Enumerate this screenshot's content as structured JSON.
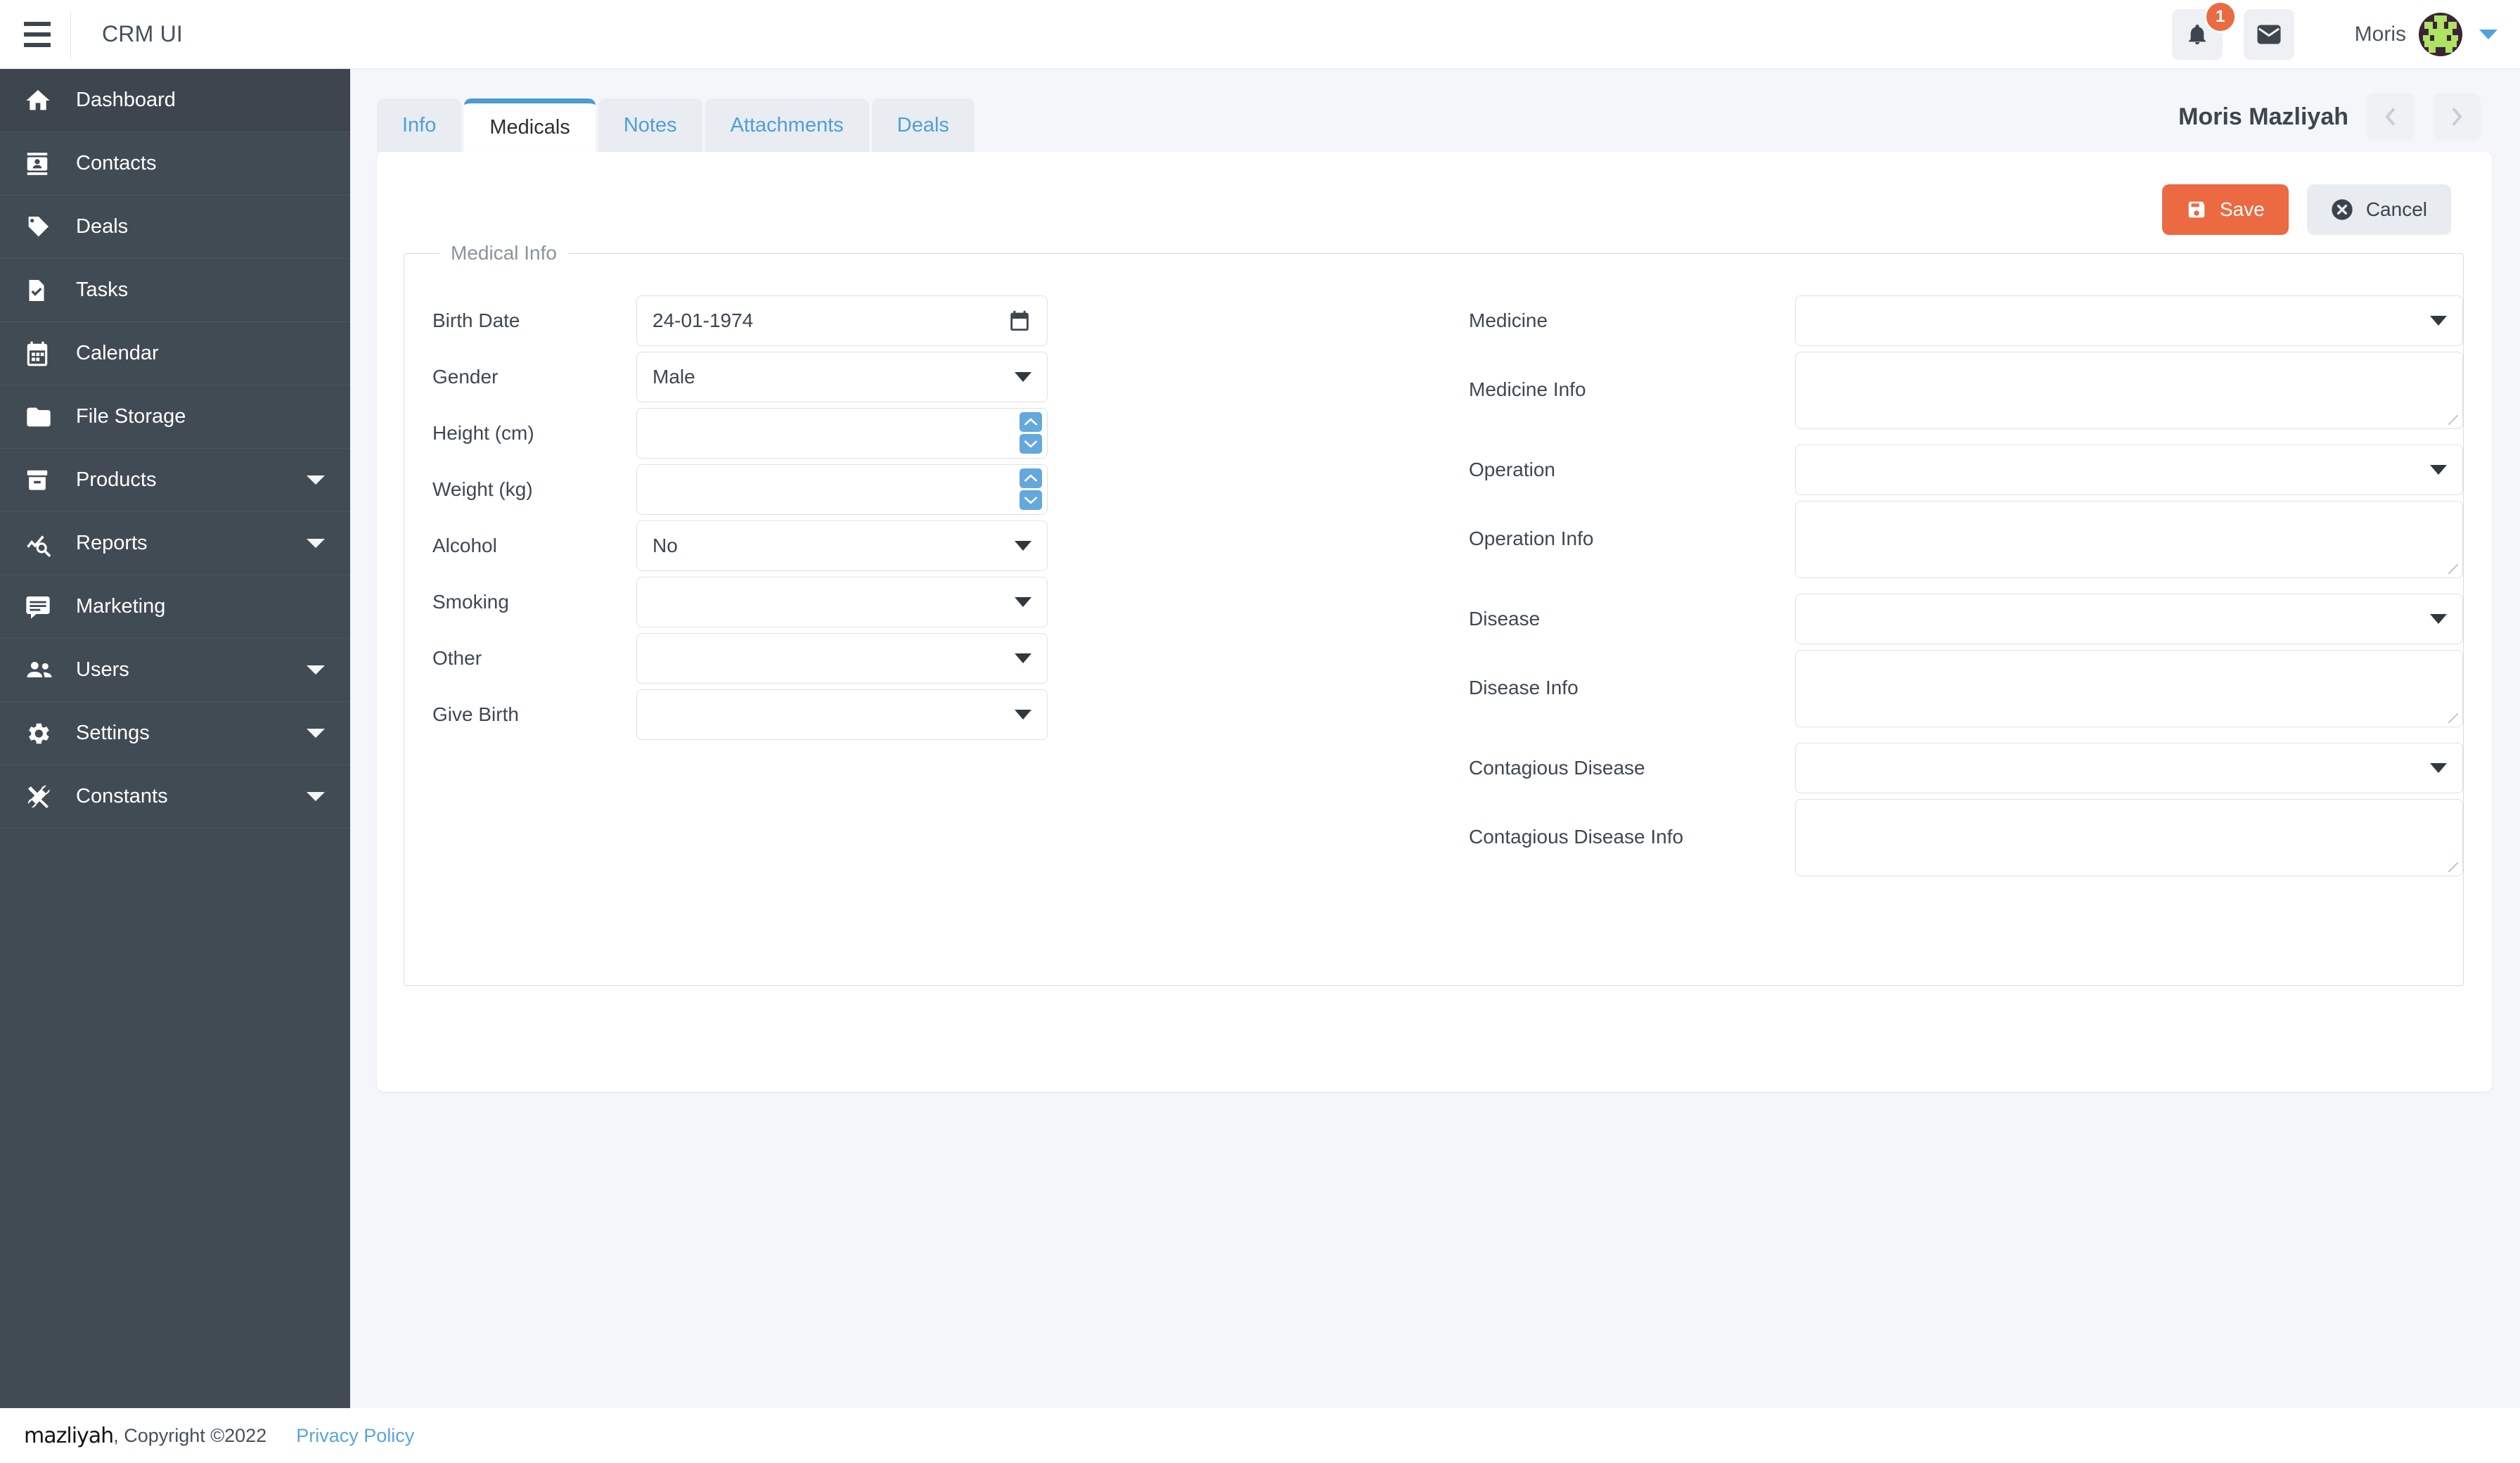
{
  "topbar": {
    "menu_icon": "hamburger-icon",
    "brand": "CRM UI",
    "notification_icon": "bell-icon",
    "notification_count": "1",
    "mail_icon": "envelope-icon",
    "user_name": "Moris",
    "avatar_icon": "identicon-avatar",
    "user_chevron_icon": "chevron-down-icon"
  },
  "sidebar": {
    "items": [
      {
        "label": "Dashboard",
        "icon": "home-icon",
        "expandable": false,
        "active": true
      },
      {
        "label": "Contacts",
        "icon": "contact-card-icon",
        "expandable": false,
        "active": false
      },
      {
        "label": "Deals",
        "icon": "tag-icon",
        "expandable": false,
        "active": false
      },
      {
        "label": "Tasks",
        "icon": "task-file-icon",
        "expandable": false,
        "active": false
      },
      {
        "label": "Calendar",
        "icon": "calendar-icon",
        "expandable": false,
        "active": false
      },
      {
        "label": "File Storage",
        "icon": "folder-icon",
        "expandable": false,
        "active": false
      },
      {
        "label": "Products",
        "icon": "box-icon",
        "expandable": true,
        "active": false
      },
      {
        "label": "Reports",
        "icon": "chart-search-icon",
        "expandable": true,
        "active": false
      },
      {
        "label": "Marketing",
        "icon": "message-icon",
        "expandable": false,
        "active": false
      },
      {
        "label": "Users",
        "icon": "people-icon",
        "expandable": true,
        "active": false
      },
      {
        "label": "Settings",
        "icon": "gear-icon",
        "expandable": true,
        "active": false
      },
      {
        "label": "Constants",
        "icon": "tools-icon",
        "expandable": true,
        "active": false
      }
    ]
  },
  "tabs": [
    {
      "label": "Info",
      "active": false
    },
    {
      "label": "Medicals",
      "active": true
    },
    {
      "label": "Notes",
      "active": false
    },
    {
      "label": "Attachments",
      "active": false
    },
    {
      "label": "Deals",
      "active": false
    }
  ],
  "record_header": {
    "name": "Moris Mazliyah",
    "prev_icon": "chevron-left-icon",
    "next_icon": "chevron-right-icon"
  },
  "actions": {
    "save_label": "Save",
    "save_icon": "floppy-disk-icon",
    "save_color": "#ec6a41",
    "cancel_label": "Cancel",
    "cancel_icon": "x-circle-icon"
  },
  "form": {
    "legend": "Medical Info",
    "left": [
      {
        "label": "Birth Date",
        "type": "date",
        "value": "24-01-1974",
        "icon": "calendar-icon"
      },
      {
        "label": "Gender",
        "type": "select",
        "value": "Male"
      },
      {
        "label": "Height (cm)",
        "type": "number",
        "value": ""
      },
      {
        "label": "Weight (kg)",
        "type": "number",
        "value": ""
      },
      {
        "label": "Alcohol",
        "type": "select",
        "value": "No"
      },
      {
        "label": "Smoking",
        "type": "select",
        "value": ""
      },
      {
        "label": "Other",
        "type": "select",
        "value": ""
      },
      {
        "label": "Give Birth",
        "type": "select",
        "value": ""
      }
    ],
    "right": [
      {
        "label": "Medicine",
        "type": "select",
        "value": ""
      },
      {
        "label": "Medicine Info",
        "type": "textarea",
        "value": ""
      },
      {
        "label": "Operation",
        "type": "select",
        "value": ""
      },
      {
        "label": "Operation Info",
        "type": "textarea",
        "value": ""
      },
      {
        "label": "Disease",
        "type": "select",
        "value": ""
      },
      {
        "label": "Disease Info",
        "type": "textarea",
        "value": ""
      },
      {
        "label": "Contagious Disease",
        "type": "select",
        "value": ""
      },
      {
        "label": "Contagious Disease Info",
        "type": "textarea",
        "value": ""
      }
    ]
  },
  "footer": {
    "logo": "mazliyah",
    "copyright": ", Copyright ©2022",
    "privacy_label": "Privacy Policy"
  },
  "colors": {
    "sidebar": "#414b54",
    "accent_blue": "#4a9ad4",
    "accent_orange": "#ec6a41",
    "page_bg": "#f4f6f9"
  }
}
